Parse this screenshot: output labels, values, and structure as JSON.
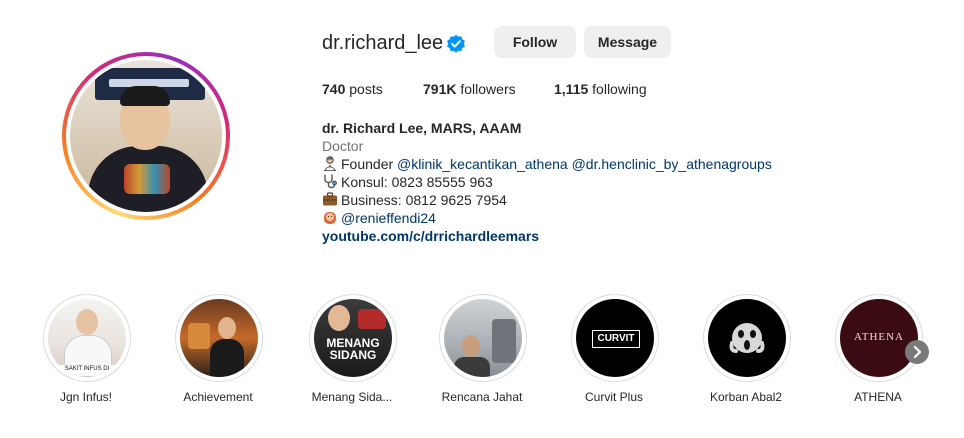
{
  "profile": {
    "username": "dr.richard_lee",
    "follow_label": "Follow",
    "message_label": "Message",
    "verified_color": "#0095f6",
    "stats": {
      "posts_count": "740",
      "posts_label": "posts",
      "followers_count": "791K",
      "followers_label": "followers",
      "following_count": "1,115",
      "following_label": "following"
    },
    "bio": {
      "name": "dr. Richard Lee, MARS, AAAM",
      "category": "Doctor",
      "line1_prefix": "Founder ",
      "line1_link1": "@klinik_kecantikan_athena",
      "line1_link2": "@dr.henclinic_by_athenagroups",
      "line2": "Konsul: 0823 85555 963",
      "line3": "Business: 0812 9625 7954",
      "line4_link": "@renieffendi24",
      "website": "youtube.com/c/drrichardleemars"
    }
  },
  "highlights": [
    {
      "label": "Jgn Infus!",
      "caption": "SAKIT INFUS DI"
    },
    {
      "label": "Achievement"
    },
    {
      "label": "Menang Sida...",
      "cover_text1": "MENANG",
      "cover_text2": "SIDANG"
    },
    {
      "label": "Rencana Jahat"
    },
    {
      "label": "Curvit Plus",
      "cover_text": "CURVIT"
    },
    {
      "label": "Korban Abal2"
    },
    {
      "label": "ATHENA",
      "cover_text": "ATHENA"
    }
  ]
}
